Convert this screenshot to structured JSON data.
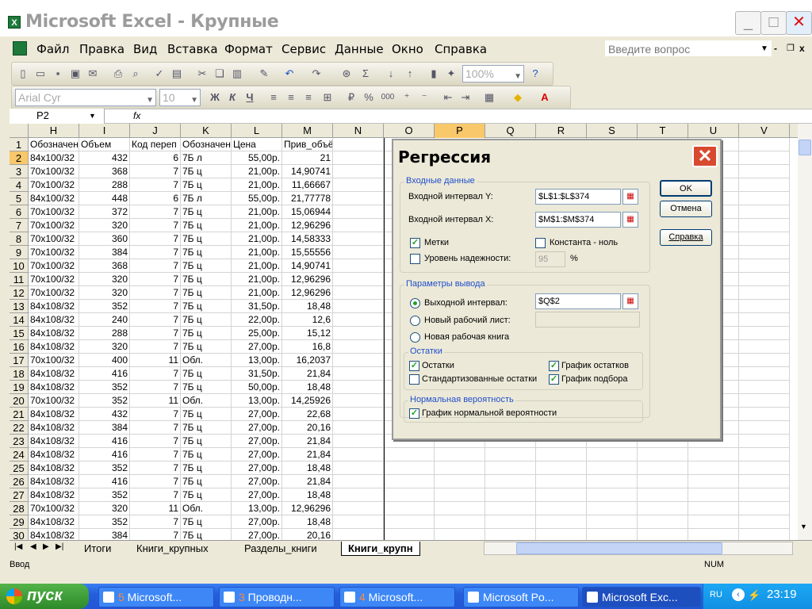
{
  "window": {
    "title": "Microsoft Excel - Крупные",
    "app_icon": "X",
    "min": "_",
    "max": "□",
    "close": "✕"
  },
  "menu": {
    "items": [
      "Файл",
      "Правка",
      "Вид",
      "Вставка",
      "Формат",
      "Сервис",
      "Данные",
      "Окно",
      "Справка"
    ],
    "help_placeholder": "Введите вопрос"
  },
  "toolbar": {
    "zoom": "100%",
    "font": "Arial Cyr",
    "size": "10",
    "bold": "Ж",
    "italic": "К",
    "underline": "Ч",
    "percent": "%",
    "thousands": "000"
  },
  "formula": {
    "namebox": "P2",
    "fx": "fx"
  },
  "columns": [
    "H",
    "I",
    "J",
    "K",
    "L",
    "M",
    "N",
    "O",
    "P",
    "Q",
    "R",
    "S",
    "T",
    "U",
    "V"
  ],
  "rows": [
    [
      "1",
      "Обозначен",
      "Объем",
      "Код переп",
      "Обозначен",
      "Цена",
      "Прив_объём"
    ],
    [
      "2",
      "84x100/32",
      "432",
      "6",
      "7Б л",
      "55,00р.",
      "21"
    ],
    [
      "3",
      "70x100/32",
      "368",
      "7",
      "7Б ц",
      "21,00р.",
      "14,90741"
    ],
    [
      "4",
      "70x100/32",
      "288",
      "7",
      "7Б ц",
      "21,00р.",
      "11,66667"
    ],
    [
      "5",
      "84x100/32",
      "448",
      "6",
      "7Б л",
      "55,00р.",
      "21,77778"
    ],
    [
      "6",
      "70x100/32",
      "372",
      "7",
      "7Б ц",
      "21,00р.",
      "15,06944"
    ],
    [
      "7",
      "70x100/32",
      "320",
      "7",
      "7Б ц",
      "21,00р.",
      "12,96296"
    ],
    [
      "8",
      "70x100/32",
      "360",
      "7",
      "7Б ц",
      "21,00р.",
      "14,58333"
    ],
    [
      "9",
      "70x100/32",
      "384",
      "7",
      "7Б ц",
      "21,00р.",
      "15,55556"
    ],
    [
      "10",
      "70x100/32",
      "368",
      "7",
      "7Б ц",
      "21,00р.",
      "14,90741"
    ],
    [
      "11",
      "70x100/32",
      "320",
      "7",
      "7Б ц",
      "21,00р.",
      "12,96296"
    ],
    [
      "12",
      "70x100/32",
      "320",
      "7",
      "7Б ц",
      "21,00р.",
      "12,96296"
    ],
    [
      "13",
      "84x108/32",
      "352",
      "7",
      "7Б ц",
      "31,50р.",
      "18,48"
    ],
    [
      "14",
      "84x108/32",
      "240",
      "7",
      "7Б ц",
      "22,00р.",
      "12,6"
    ],
    [
      "15",
      "84x108/32",
      "288",
      "7",
      "7Б ц",
      "25,00р.",
      "15,12"
    ],
    [
      "16",
      "84x108/32",
      "320",
      "7",
      "7Б ц",
      "27,00р.",
      "16,8"
    ],
    [
      "17",
      "70x100/32",
      "400",
      "11",
      "Обл.",
      "13,00р.",
      "16,2037"
    ],
    [
      "18",
      "84x108/32",
      "416",
      "7",
      "7Б ц",
      "31,50р.",
      "21,84"
    ],
    [
      "19",
      "84x108/32",
      "352",
      "7",
      "7Б ц",
      "50,00р.",
      "18,48"
    ],
    [
      "20",
      "70x100/32",
      "352",
      "11",
      "Обл.",
      "13,00р.",
      "14,25926"
    ],
    [
      "21",
      "84x108/32",
      "432",
      "7",
      "7Б ц",
      "27,00р.",
      "22,68"
    ],
    [
      "22",
      "84x108/32",
      "384",
      "7",
      "7Б ц",
      "27,00р.",
      "20,16"
    ],
    [
      "23",
      "84x108/32",
      "416",
      "7",
      "7Б ц",
      "27,00р.",
      "21,84"
    ],
    [
      "24",
      "84x108/32",
      "416",
      "7",
      "7Б ц",
      "27,00р.",
      "21,84"
    ],
    [
      "25",
      "84x108/32",
      "352",
      "7",
      "7Б ц",
      "27,00р.",
      "18,48"
    ],
    [
      "26",
      "84x108/32",
      "416",
      "7",
      "7Б ц",
      "27,00р.",
      "21,84"
    ],
    [
      "27",
      "84x108/32",
      "352",
      "7",
      "7Б ц",
      "27,00р.",
      "18,48"
    ],
    [
      "28",
      "70x100/32",
      "320",
      "11",
      "Обл.",
      "13,00р.",
      "12,96296"
    ],
    [
      "29",
      "84x108/32",
      "352",
      "7",
      "7Б ц",
      "27,00р.",
      "18,48"
    ],
    [
      "30",
      "84x108/32",
      "384",
      "7",
      "7Б ц",
      "27,00р.",
      "20,16"
    ]
  ],
  "sheet_tabs": [
    "Итоги",
    "Книги_крупных",
    "Разделы_книги",
    "Книги_крупн"
  ],
  "status": {
    "left": "Ввод",
    "num": "NUM"
  },
  "dialog": {
    "title": "Регрессия",
    "input_group": "Входные данные",
    "y_label": "Входной интервал Y:",
    "y_value": "$L$1:$L$374",
    "x_label": "Входной интервал X:",
    "x_value": "$M$1:$M$374",
    "labels": "Метки",
    "constant": "Константа - ноль",
    "confidence": "Уровень надежности:",
    "confidence_value": "95",
    "percent": "%",
    "output_group": "Параметры вывода",
    "output_range": "Выходной интервал:",
    "output_value": "$Q$2",
    "new_sheet": "Новый рабочий лист:",
    "new_book": "Новая рабочая книга",
    "residuals_group": "Остатки",
    "residuals": "Остатки",
    "std_residuals": "Стандартизованные остатки",
    "residual_plots": "График остатков",
    "line_fit": "График подбора",
    "normal_group": "Нормальная вероятность",
    "normal_plot": "График нормальной вероятности",
    "ok": "OK",
    "cancel": "Отмена",
    "help": "Справка"
  },
  "taskbar": {
    "start": "пуск",
    "tasks": [
      {
        "num": "5",
        "label": " Microsoft..."
      },
      {
        "num": "3",
        "label": " Проводн..."
      },
      {
        "num": "4",
        "label": " Microsoft..."
      },
      {
        "num": "",
        "label": "Microsoft Po..."
      },
      {
        "num": "",
        "label": "Microsoft Exc..."
      }
    ],
    "lang": "RU",
    "clock": "23:19"
  }
}
